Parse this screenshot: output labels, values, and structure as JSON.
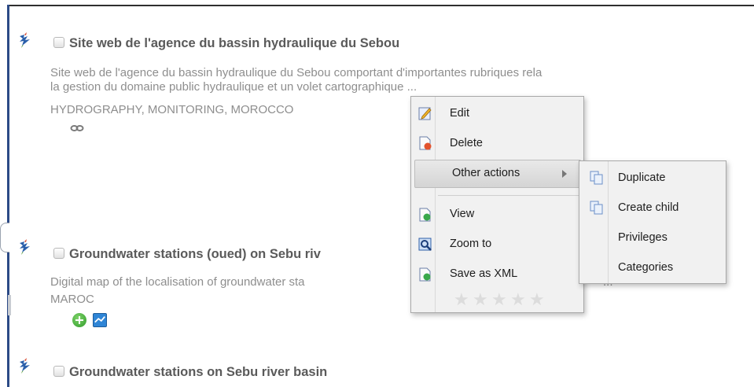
{
  "results": [
    {
      "title": "Site web de l'agence du bassin hydraulique du Sebou",
      "abstract_line1": "Site web de l'agence du bassin hydraulique du Sebou comportant d'importantes rubriques rela",
      "abstract_line2": "la gestion du domaine public hydraulique et un volet cartographique ...",
      "keywords": "HYDROGRAPHY, MONITORING, MOROCCO",
      "icons": [
        "bird-logo-icon",
        "link-icon"
      ]
    },
    {
      "title": "Groundwater stations (oued) on Sebu riv",
      "abstract_line1": "Digital map of the localisation of groundwater sta",
      "abstract_tail": "...",
      "keywords": "MAROC",
      "icons": [
        "bird-logo-icon",
        "add-icon",
        "map-icon"
      ]
    },
    {
      "title": "Groundwater stations on Sebu river basin",
      "icons": [
        "bird-logo-icon"
      ]
    }
  ],
  "context_menu": {
    "items": [
      {
        "label": "Edit",
        "icon": "edit-icon"
      },
      {
        "label": "Delete",
        "icon": "delete-icon"
      },
      {
        "label": "Other actions",
        "icon": "",
        "has_submenu": true
      },
      {
        "label": "View",
        "icon": "view-icon"
      },
      {
        "label": "Zoom to",
        "icon": "zoom-icon"
      },
      {
        "label": "Save as XML",
        "icon": "xml-icon"
      }
    ],
    "rating": {
      "value": 0,
      "max": 5
    }
  },
  "submenu": {
    "items": [
      {
        "label": "Duplicate",
        "icon": "duplicate-icon"
      },
      {
        "label": "Create child",
        "icon": "create-child-icon"
      },
      {
        "label": "Privileges",
        "icon": ""
      },
      {
        "label": "Categories",
        "icon": ""
      }
    ]
  },
  "colors": {
    "accent_rule": "#2c4a86",
    "title_text": "#5a5a5a",
    "body_text": "#8e8e8e",
    "menu_bg": "#f1f1f1"
  }
}
